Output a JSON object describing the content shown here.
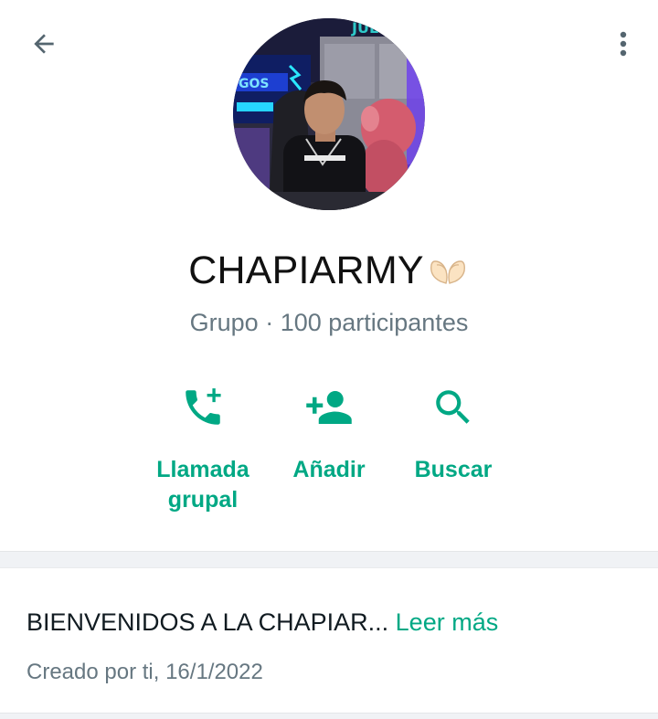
{
  "header": {
    "back_icon": "arrow-left-icon",
    "menu_icon": "more-vert-icon"
  },
  "group": {
    "name": "CHAPIARMY",
    "name_emoji": "heart-hands-icon",
    "subtitle": "Grupo · 100 participantes"
  },
  "actions": [
    {
      "label_line1": "Llamada",
      "label_line2": "grupal",
      "icon": "phone-add-icon"
    },
    {
      "label": "Añadir",
      "icon": "person-add-icon"
    },
    {
      "label": "Buscar",
      "icon": "search-icon"
    }
  ],
  "description": {
    "text": "BIENVENIDOS A LA CHAPIAR...",
    "more_label": "Leer más",
    "created": "Creado por ti, 16/1/2022"
  },
  "colors": {
    "accent": "#00a884",
    "secondary_text": "#667781",
    "primary_text": "#111b21",
    "divider": "#f0f2f5"
  }
}
